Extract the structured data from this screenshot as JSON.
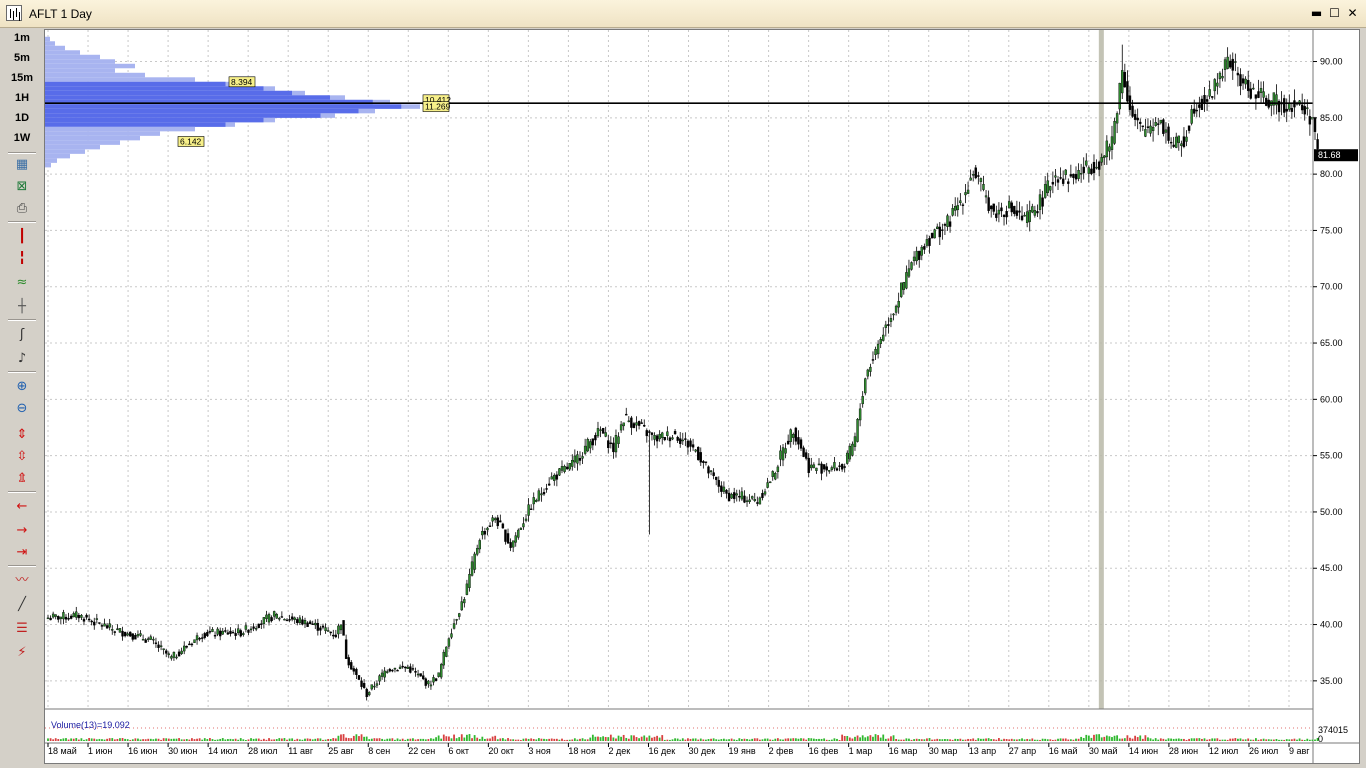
{
  "window": {
    "title": "AFLT 1 Day",
    "minimize_glyph": "▬",
    "maximize_glyph": "☐",
    "close_glyph": "✕"
  },
  "toolbar": {
    "timeframes": [
      "1m",
      "5m",
      "15m",
      "1H",
      "1D",
      "1W"
    ],
    "tools": [
      {
        "name": "chart-properties-icon",
        "glyph": "▦",
        "color": "#3a6ea5"
      },
      {
        "name": "excel-export-icon",
        "glyph": "⊠",
        "color": "#1f7a3a"
      },
      {
        "name": "print-icon",
        "glyph": "⎙",
        "color": "#444444"
      },
      {
        "name": "candlestick-icon",
        "glyph": "┃",
        "color": "#c00000"
      },
      {
        "name": "bar-chart-icon",
        "glyph": "╏",
        "color": "#c00000"
      },
      {
        "name": "line-chart-icon",
        "glyph": "≈",
        "color": "#2a8a2a"
      },
      {
        "name": "crosshair-icon",
        "glyph": "┼",
        "color": "#555555"
      },
      {
        "name": "cursor-line-icon",
        "glyph": "ʃ",
        "color": "#333333"
      },
      {
        "name": "cursor-bold-icon",
        "glyph": "♪",
        "color": "#333333"
      },
      {
        "name": "zoom-in-icon",
        "glyph": "⊕",
        "color": "#2060b0"
      },
      {
        "name": "zoom-out-icon",
        "glyph": "⊖",
        "color": "#2060b0"
      },
      {
        "name": "stretch-vertical-icon",
        "glyph": "⇕",
        "color": "#d01010"
      },
      {
        "name": "compress-vertical-icon",
        "glyph": "⇳",
        "color": "#d01010"
      },
      {
        "name": "fit-vertical-icon",
        "glyph": "⇭",
        "color": "#d01010"
      },
      {
        "name": "scroll-left-icon",
        "glyph": "←",
        "color": "#d01010"
      },
      {
        "name": "scroll-right-icon",
        "glyph": "→",
        "color": "#d01010"
      },
      {
        "name": "scroll-end-icon",
        "glyph": "⇥",
        "color": "#d01010"
      },
      {
        "name": "indicator-icon",
        "glyph": "〰",
        "color": "#c02020"
      },
      {
        "name": "draw-line-icon",
        "glyph": "╱",
        "color": "#333333"
      },
      {
        "name": "fibonacci-icon",
        "glyph": "☰",
        "color": "#c02020"
      },
      {
        "name": "delete-drawings-icon",
        "glyph": "⚡",
        "color": "#c02020"
      }
    ]
  },
  "chart_data": {
    "type": "candlestick",
    "symbol": "AFLT",
    "timeframe": "1 Day",
    "ylim": [
      32.5,
      92.8
    ],
    "y_ticks": [
      "35.00",
      "40.00",
      "45.00",
      "50.00",
      "55.00",
      "60.00",
      "65.00",
      "70.00",
      "75.00",
      "80.00",
      "85.00",
      "90.00"
    ],
    "x_labels": [
      "18 май",
      "1 июн",
      "16 июн",
      "30 июн",
      "14 июл",
      "28 июл",
      "11 авг",
      "25 авг",
      "8 сен",
      "22 сен",
      "6 окт",
      "20 окт",
      "3 ноя",
      "18 ноя",
      "2 дек",
      "16 дек",
      "30 дек",
      "19 янв",
      "2 фев",
      "16 фев",
      "1 мар",
      "16 мар",
      "30 мар",
      "13 апр",
      "27 апр",
      "16 май",
      "30 май",
      "14 июн",
      "28 июн",
      "12 июл",
      "26 июл",
      "9 авг"
    ],
    "last_price": "81.68",
    "horizontal_line": 86.3,
    "highlight_label": "30 май",
    "close_anchors": [
      [
        0,
        40.6
      ],
      [
        12,
        40.8
      ],
      [
        25,
        39.6
      ],
      [
        40,
        38.6
      ],
      [
        48,
        37.0
      ],
      [
        60,
        39.2
      ],
      [
        75,
        39.3
      ],
      [
        88,
        40.8
      ],
      [
        102,
        40.1
      ],
      [
        112,
        39.1
      ],
      [
        114,
        40.3
      ],
      [
        116,
        37.2
      ],
      [
        120,
        35.4
      ],
      [
        124,
        33.8
      ],
      [
        132,
        36.1
      ],
      [
        140,
        36.2
      ],
      [
        148,
        34.7
      ],
      [
        152,
        35.5
      ],
      [
        156,
        39.0
      ],
      [
        162,
        42.5
      ],
      [
        168,
        47.8
      ],
      [
        174,
        49.5
      ],
      [
        180,
        47.0
      ],
      [
        188,
        50.6
      ],
      [
        196,
        53.0
      ],
      [
        204,
        54.2
      ],
      [
        210,
        56.0
      ],
      [
        215,
        57.2
      ],
      [
        220,
        55.6
      ],
      [
        224,
        58.4
      ],
      [
        230,
        57.6
      ],
      [
        236,
        56.5
      ],
      [
        244,
        56.9
      ],
      [
        252,
        55.5
      ],
      [
        258,
        53.2
      ],
      [
        264,
        51.5
      ],
      [
        270,
        51.3
      ],
      [
        276,
        51.0
      ],
      [
        282,
        53.2
      ],
      [
        286,
        55.5
      ],
      [
        290,
        57.4
      ],
      [
        296,
        54.0
      ],
      [
        304,
        53.9
      ],
      [
        310,
        54.1
      ],
      [
        314,
        56.5
      ],
      [
        318,
        62.0
      ],
      [
        324,
        65.5
      ],
      [
        330,
        68.5
      ],
      [
        336,
        72.0
      ],
      [
        342,
        74.2
      ],
      [
        350,
        75.6
      ],
      [
        356,
        78.0
      ],
      [
        360,
        80.3
      ],
      [
        368,
        76.5
      ],
      [
        374,
        77.0
      ],
      [
        380,
        75.8
      ],
      [
        386,
        77.5
      ],
      [
        392,
        80.0
      ],
      [
        398,
        79.6
      ],
      [
        404,
        80.5
      ],
      [
        410,
        81.3
      ],
      [
        414,
        83.0
      ],
      [
        418,
        89.3
      ],
      [
        422,
        85.0
      ],
      [
        426,
        83.7
      ],
      [
        432,
        85.0
      ],
      [
        438,
        82.5
      ],
      [
        442,
        83.0
      ],
      [
        446,
        86.2
      ],
      [
        452,
        86.8
      ],
      [
        456,
        89.0
      ],
      [
        460,
        90.0
      ],
      [
        464,
        88.3
      ],
      [
        470,
        87.0
      ],
      [
        478,
        86.3
      ],
      [
        486,
        86.2
      ],
      [
        492,
        85.0
      ],
      [
        494,
        81.7
      ]
    ],
    "volume": {
      "label": "Volume(13)=19.092",
      "axis_max": "374015",
      "axis_zero": "0"
    },
    "volume_profile": {
      "labels": [
        "8.394",
        "10.412",
        "11.269",
        "6.142"
      ],
      "bins": [
        [
          92.0,
          5
        ],
        [
          91.6,
          10
        ],
        [
          91.2,
          20
        ],
        [
          90.8,
          35
        ],
        [
          90.4,
          55
        ],
        [
          90.0,
          70
        ],
        [
          89.6,
          90
        ],
        [
          89.2,
          70
        ],
        [
          88.8,
          100
        ],
        [
          88.4,
          150
        ],
        [
          88.0,
          190
        ],
        [
          87.6,
          230
        ],
        [
          87.2,
          260
        ],
        [
          86.8,
          300
        ],
        [
          86.4,
          345
        ],
        [
          86.0,
          375
        ],
        [
          85.6,
          330
        ],
        [
          85.2,
          290
        ],
        [
          84.8,
          230
        ],
        [
          84.4,
          190
        ],
        [
          84.0,
          150
        ],
        [
          83.6,
          115
        ],
        [
          83.2,
          95
        ],
        [
          82.8,
          75
        ],
        [
          82.4,
          55
        ],
        [
          82.0,
          40
        ],
        [
          81.6,
          25
        ],
        [
          81.2,
          12
        ],
        [
          80.8,
          6
        ]
      ]
    }
  }
}
